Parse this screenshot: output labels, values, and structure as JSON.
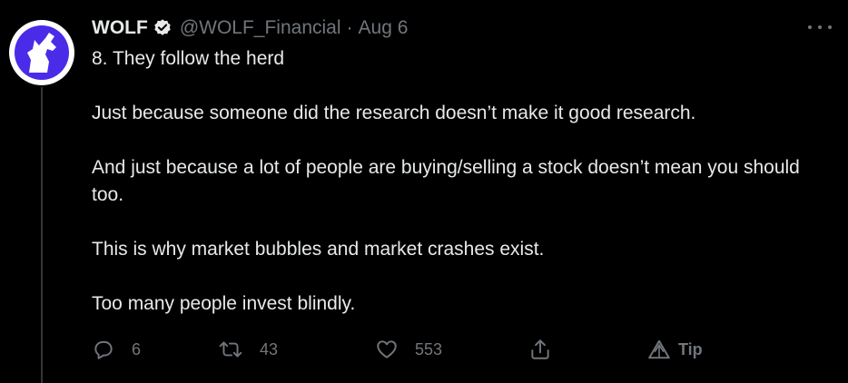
{
  "tweet": {
    "author_name": "WOLF",
    "handle": "@WOLF_Financial",
    "separator": "·",
    "date": "Aug 6",
    "paragraphs": [
      "8. They follow the herd",
      "Just because someone did the research doesn’t make it good research.",
      "And just because a lot of people are buying/selling a stock doesn’t mean you should too.",
      "This is why market bubbles and market crashes exist.",
      "Too many people invest blindly."
    ]
  },
  "actions": {
    "reply_count": "6",
    "retweet_count": "43",
    "like_count": "553",
    "tip_label": "Tip"
  },
  "colors": {
    "background": "#000000",
    "text": "#e7e9ea",
    "secondary": "#71767b",
    "avatar_brand": "#4a2be8"
  }
}
